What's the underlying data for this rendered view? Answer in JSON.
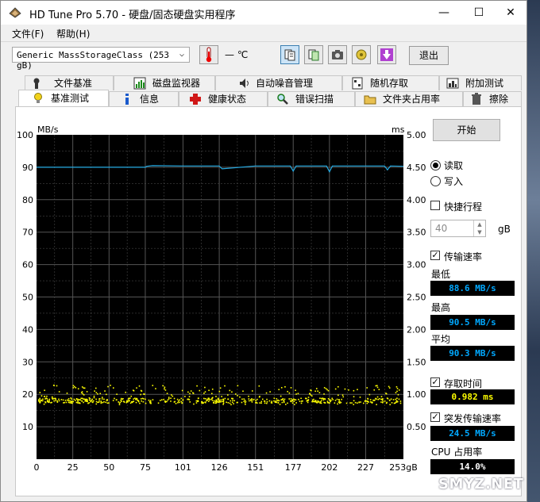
{
  "window": {
    "title": "HD Tune Pro 5.70 - 硬盘/固态硬盘实用程序",
    "minimize": "—",
    "maximize": "☐",
    "close": "✕"
  },
  "menu": {
    "file": "文件(F)",
    "help": "帮助(H)"
  },
  "toolbar": {
    "drive": "Generic MassStorageClass (253 gB)",
    "temperature": "— ℃",
    "exit": "退出",
    "icons": [
      "thermometer-icon",
      "copy-info-icon",
      "save-icon",
      "camera-icon",
      "options-icon",
      "download-icon"
    ]
  },
  "tabs_top": [
    "文件基准",
    "磁盘监视器",
    "自动噪音管理",
    "随机存取",
    "附加测试"
  ],
  "tabs_bottom": [
    "基准测试",
    "信息",
    "健康状态",
    "错误扫描",
    "文件夹占用率",
    "擦除"
  ],
  "controls": {
    "start": "开始",
    "read": "读取",
    "write": "写入",
    "short_stroke": "快捷行程",
    "stroke_value": "40",
    "stroke_unit": "gB",
    "transfer_rate": "传输速率",
    "min_label": "最低",
    "min_value": "88.6 MB/s",
    "max_label": "最高",
    "max_value": "90.5 MB/s",
    "avg_label": "平均",
    "avg_value": "90.3 MB/s",
    "access_time": "存取时间",
    "access_value": "0.982 ms",
    "burst_rate": "突发传输速率",
    "burst_value": "24.5 MB/s",
    "cpu_label": "CPU 占用率",
    "cpu_value": "14.0%"
  },
  "watermark": "SMYZ.NET",
  "colors": {
    "read_line": "#23a9e2",
    "access_dots": "#ffff00",
    "chart_bg": "#000000",
    "grid": "#555555"
  },
  "chart_data": {
    "type": "line",
    "y_left_label": "MB/s",
    "y_right_label": "ms",
    "x_unit": "gB",
    "x_ticks": [
      "0",
      "25",
      "50",
      "75",
      "101",
      "126",
      "151",
      "177",
      "202",
      "227",
      "253"
    ],
    "y_left_ticks": [
      "10",
      "20",
      "30",
      "40",
      "50",
      "60",
      "70",
      "80",
      "90",
      "100"
    ],
    "y_right_ticks": [
      "0.50",
      "1.00",
      "1.50",
      "2.00",
      "2.50",
      "3.00",
      "3.50",
      "4.00",
      "4.50",
      "5.00"
    ],
    "ylim_left": [
      0,
      100
    ],
    "ylim_right": [
      0,
      5
    ],
    "xlim": [
      0,
      253
    ],
    "grid": true,
    "series": [
      {
        "name": "读取",
        "x": [
          0,
          25,
          50,
          75,
          76,
          80,
          101,
          126,
          128,
          151,
          175,
          177,
          179,
          200,
          202,
          204,
          227,
          240,
          242,
          244,
          253
        ],
        "y": [
          90,
          90,
          90,
          90,
          90.3,
          90.5,
          90.4,
          90.4,
          89.5,
          90.4,
          90.4,
          88.8,
          90.4,
          90.4,
          88.6,
          90.4,
          90.4,
          90.4,
          89.2,
          90.4,
          90.3
        ]
      }
    ],
    "access_time_ms": {
      "typical_range": [
        0.85,
        1.15
      ],
      "average": 0.982
    }
  }
}
